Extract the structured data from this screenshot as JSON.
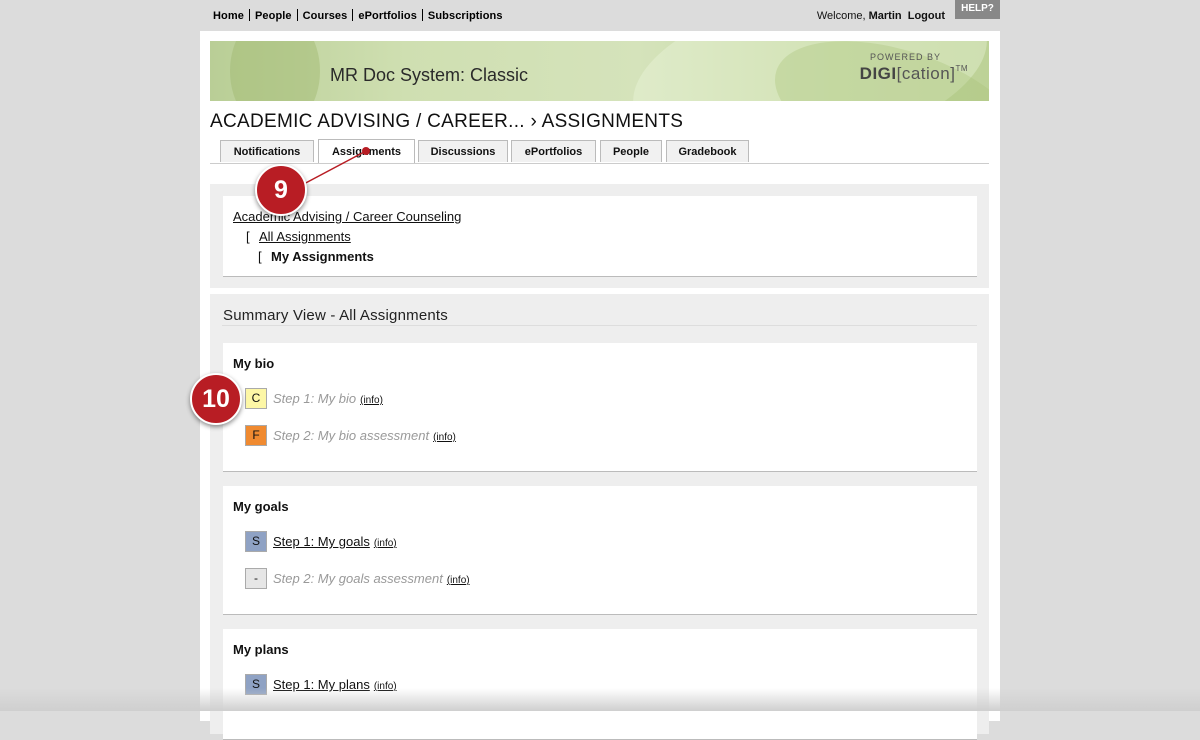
{
  "topnav": {
    "items": [
      "Home",
      "People",
      "Courses",
      "ePortfolios",
      "Subscriptions"
    ]
  },
  "user": {
    "welcome": "Welcome,",
    "name": "Martin",
    "logout": "Logout"
  },
  "help": "HELP?",
  "banner": {
    "title": "MR Doc System: Classic",
    "powered_by": "POWERED BY",
    "brand_bold": "DIGI",
    "brand_rest": "[cation]",
    "brand_tm": "TM"
  },
  "course_title": "ACADEMIC ADVISING / CAREER... › ASSIGNMENTS",
  "tabs": [
    {
      "label": "Notifications",
      "active": false
    },
    {
      "label": "Assignments",
      "active": true
    },
    {
      "label": "Discussions",
      "active": false
    },
    {
      "label": "ePortfolios",
      "active": false
    },
    {
      "label": "People",
      "active": false
    },
    {
      "label": "Gradebook",
      "active": false
    }
  ],
  "breadcrumb": {
    "mark": "[",
    "level1": "Academic Advising / Career Counseling",
    "level2": "All Assignments",
    "level3": "My Assignments"
  },
  "summary": {
    "title": "Summary View - All Assignments",
    "info_label": "(info)",
    "groups": [
      {
        "title": "My bio",
        "steps": [
          {
            "badge": "C",
            "badge_color": "#fdf7a6",
            "label": "Step 1: My bio",
            "link": false
          },
          {
            "badge": "F",
            "badge_color": "#f08a30",
            "label": "Step 2: My bio assessment",
            "link": false
          }
        ]
      },
      {
        "title": "My goals",
        "steps": [
          {
            "badge": "S",
            "badge_color": "#8fa2c4",
            "label": "Step 1: My goals",
            "link": true
          },
          {
            "badge": "-",
            "badge_color": "#e6e6e6",
            "label": "Step 2: My goals assessment",
            "link": false
          }
        ]
      },
      {
        "title": "My plans",
        "steps": [
          {
            "badge": "S",
            "badge_color": "#8fa2c4",
            "label": "Step 1: My plans",
            "link": true
          }
        ]
      }
    ]
  },
  "callouts": [
    {
      "number": "9"
    },
    {
      "number": "10"
    }
  ],
  "colors": {
    "callout": "#b81d24",
    "banner": "#c8dba8"
  }
}
